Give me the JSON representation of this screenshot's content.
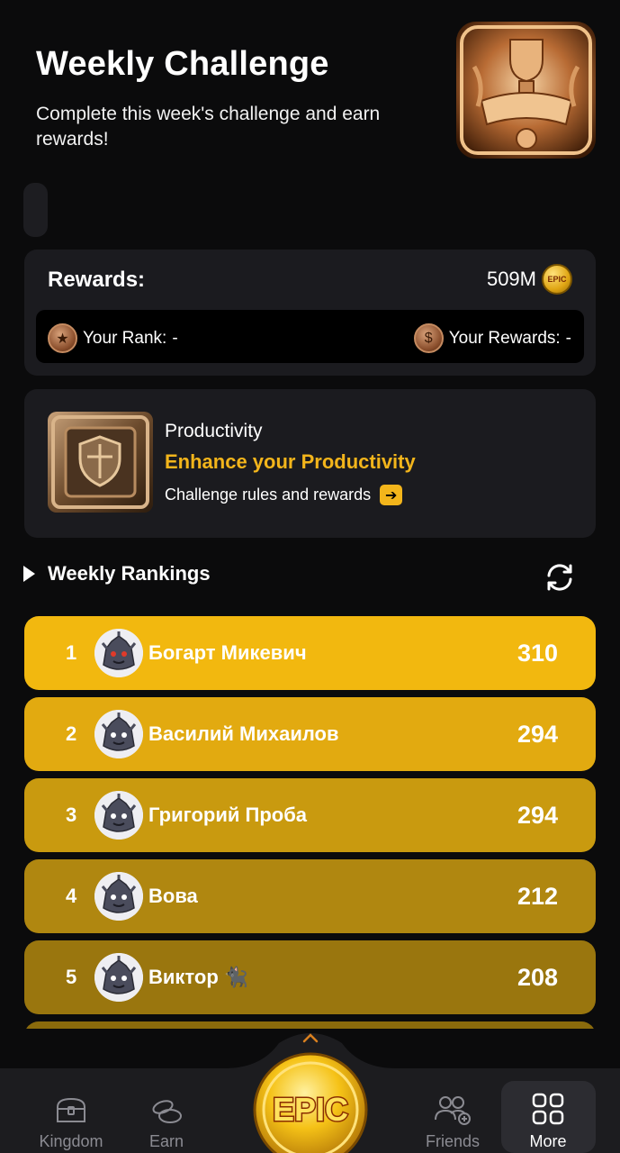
{
  "header": {
    "title": "Weekly Challenge",
    "subtitle": "Complete this week's challenge and earn rewards!"
  },
  "rewards": {
    "label": "Rewards:",
    "amount": "509M",
    "coin_text": "EPIC",
    "your_rank_label": "Your Rank:",
    "your_rank_value": "-",
    "your_rewards_label": "Your Rewards:",
    "your_rewards_value": "-"
  },
  "productivity": {
    "category": "Productivity",
    "headline": "Enhance your Productivity",
    "rules_link": "Challenge rules and rewards",
    "arrow": "➔"
  },
  "rankings": {
    "title": "Weekly Rankings",
    "rows": [
      {
        "rank": "1",
        "name": "Богарт Микевич",
        "score": "310",
        "color": "#f2b80f"
      },
      {
        "rank": "2",
        "name": "Василий Михаилов",
        "score": "294",
        "color": "#e2aa10"
      },
      {
        "rank": "3",
        "name": "Григорий Проба",
        "score": "294",
        "color": "#c99a0f"
      },
      {
        "rank": "4",
        "name": "Вова",
        "score": "212",
        "color": "#b08710"
      },
      {
        "rank": "5",
        "name": "Виктор 🐈‍⬛",
        "score": "208",
        "color": "#9a760e"
      }
    ]
  },
  "nav": {
    "kingdom": "Kingdom",
    "earn": "Earn",
    "center": "EPIC",
    "friends": "Friends",
    "more": "More"
  },
  "colors": {
    "accent": "#f3b51b",
    "card": "#1b1b1f",
    "background": "#0b0b0c"
  }
}
